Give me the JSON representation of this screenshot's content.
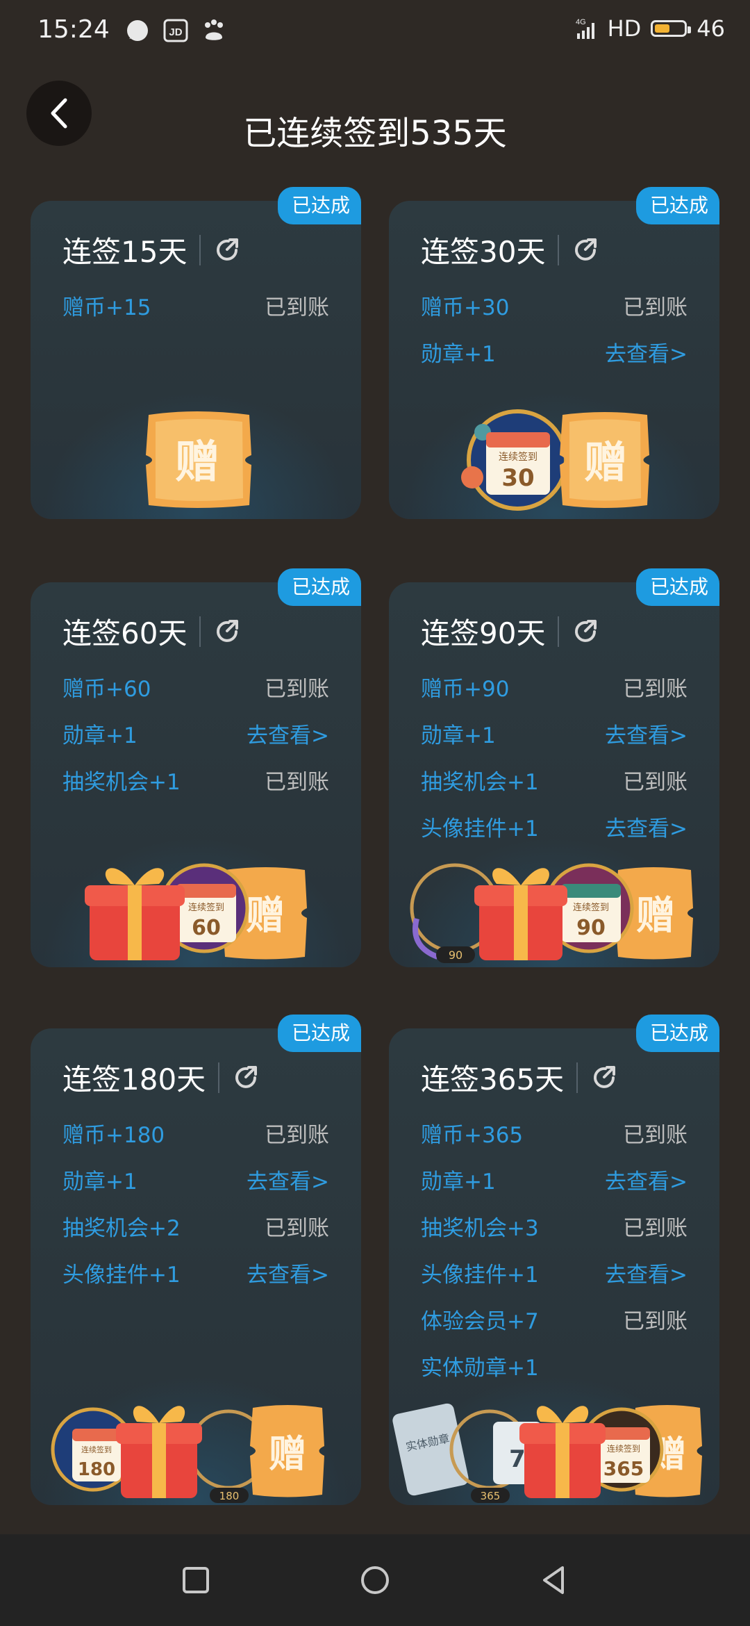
{
  "status_bar": {
    "time": "15:24",
    "network": "4G",
    "hd": "HD",
    "battery_level": "46"
  },
  "header": {
    "title": "已连续签到535天"
  },
  "labels": {
    "achieved": "已达成"
  },
  "cards": [
    {
      "title": "连签15天",
      "rows": [
        {
          "reward": "赠币+15",
          "status": "已到账"
        }
      ]
    },
    {
      "title": "连签30天",
      "rows": [
        {
          "reward": "赠币+30",
          "status": "已到账"
        },
        {
          "reward": "勋章+1",
          "status": "去查看>"
        }
      ]
    },
    {
      "title": "连签60天",
      "rows": [
        {
          "reward": "赠币+60",
          "status": "已到账"
        },
        {
          "reward": "勋章+1",
          "status": "去查看>"
        },
        {
          "reward": "抽奖机会+1",
          "status": "已到账"
        }
      ]
    },
    {
      "title": "连签90天",
      "rows": [
        {
          "reward": "赠币+90",
          "status": "已到账"
        },
        {
          "reward": "勋章+1",
          "status": "去查看>"
        },
        {
          "reward": "抽奖机会+1",
          "status": "已到账"
        },
        {
          "reward": "头像挂件+1",
          "status": "去查看>"
        }
      ]
    },
    {
      "title": "连签180天",
      "rows": [
        {
          "reward": "赠币+180",
          "status": "已到账"
        },
        {
          "reward": "勋章+1",
          "status": "去查看>"
        },
        {
          "reward": "抽奖机会+2",
          "status": "已到账"
        },
        {
          "reward": "头像挂件+1",
          "status": "去查看>"
        }
      ]
    },
    {
      "title": "连签365天",
      "rows": [
        {
          "reward": "赠币+365",
          "status": "已到账"
        },
        {
          "reward": "勋章+1",
          "status": "去查看>"
        },
        {
          "reward": "抽奖机会+3",
          "status": "已到账"
        },
        {
          "reward": "头像挂件+1",
          "status": "去查看>"
        },
        {
          "reward": "体验会员+7",
          "status": "已到账"
        },
        {
          "reward": "实体勋章+1",
          "status": ""
        }
      ]
    }
  ],
  "art_text": {
    "gift_char": "赠",
    "calendar_label": "连续签到",
    "medal_30": "30",
    "medal_60": "60",
    "medal_90": "90",
    "medal_180": "180",
    "medal_365": "365",
    "frame_90": "90",
    "frame_180": "180",
    "frame_365": "365",
    "physical_medal": "实体勋章",
    "vip_days": "7"
  }
}
